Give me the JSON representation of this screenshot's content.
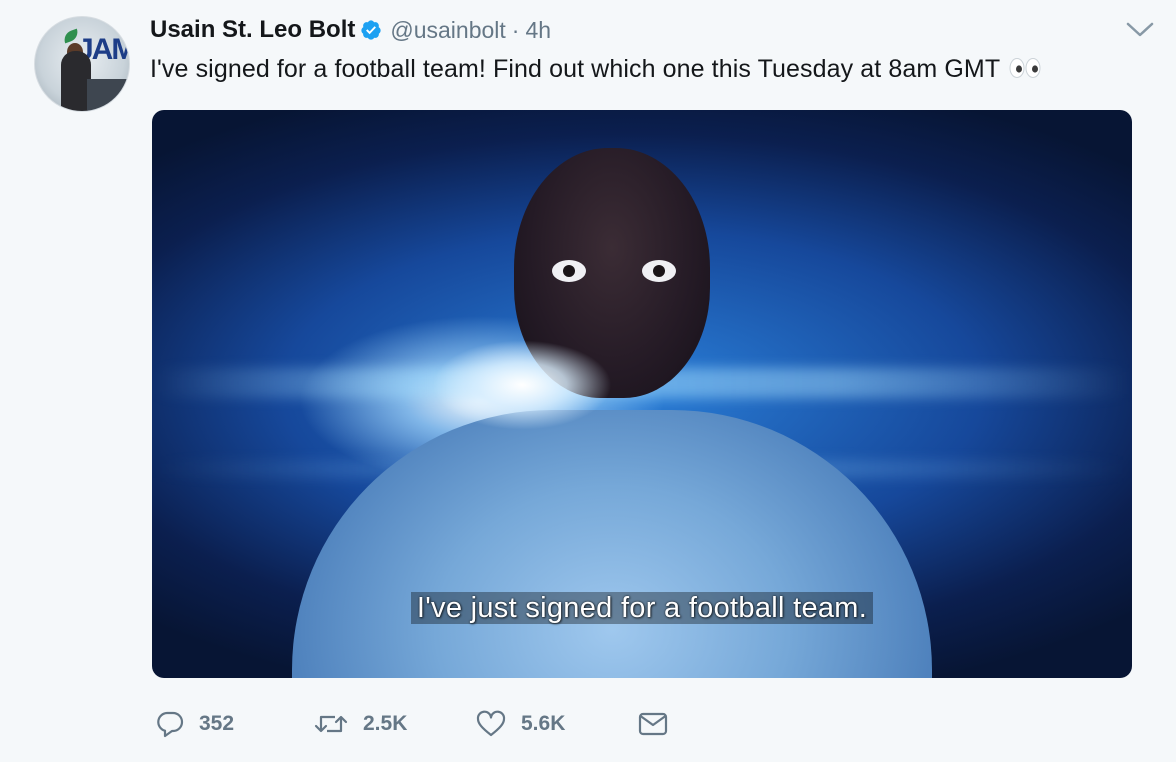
{
  "tweet": {
    "author_name": "Usain St. Leo Bolt",
    "handle": "@usainbolt",
    "separator": "·",
    "time": "4h",
    "text": "I've signed for a football team! Find out which one this Tuesday at 8am GMT",
    "emoji_icon": "eyes-emoji-icon",
    "verified_icon": "verified-badge-icon",
    "menu_icon": "chevron-down-icon",
    "avatar_logo_text": "JAM"
  },
  "media": {
    "subtitle": "I've just signed for a football team."
  },
  "actions": {
    "reply_count": "352",
    "retweet_count": "2.5K",
    "like_count": "5.6K",
    "reply_icon": "reply-icon",
    "retweet_icon": "retweet-icon",
    "like_icon": "heart-icon",
    "dm_icon": "envelope-icon"
  },
  "colors": {
    "background": "#f5f8fa",
    "text": "#14171a",
    "secondary_text": "#657786",
    "verified": "#1da1f2"
  }
}
